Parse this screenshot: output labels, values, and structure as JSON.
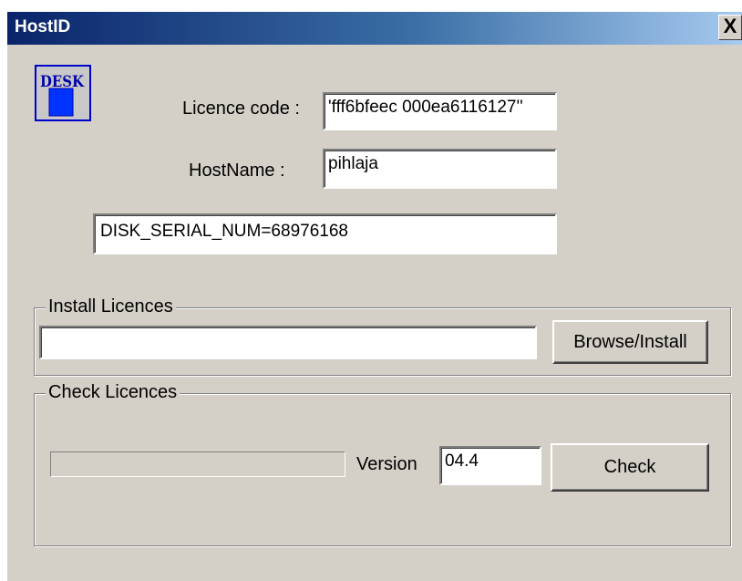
{
  "window": {
    "title": "HostID",
    "close_label": "X"
  },
  "logo": {
    "text": "DESK",
    "icon": "desk-logo-icon"
  },
  "info": {
    "licence_code_label": "Licence code :",
    "licence_code_value": "'fff6bfeec 000ea6116127''",
    "hostname_label": "HostName :",
    "hostname_value": "pihlaja",
    "disk_serial_value": "DISK_SERIAL_NUM=68976168"
  },
  "install": {
    "group_label": "Install Licences",
    "path_value": "",
    "browse_label": "Browse/Install"
  },
  "check": {
    "group_label": "Check Licences",
    "progress": 0,
    "version_label": "Version",
    "version_value": "04.4",
    "check_label": "Check"
  },
  "colors": {
    "window_bg": "#d4d0c8",
    "title_start": "#0a246a",
    "title_end": "#a6caf0",
    "logo_border": "#0000cc",
    "logo_fill": "#0033ff"
  }
}
